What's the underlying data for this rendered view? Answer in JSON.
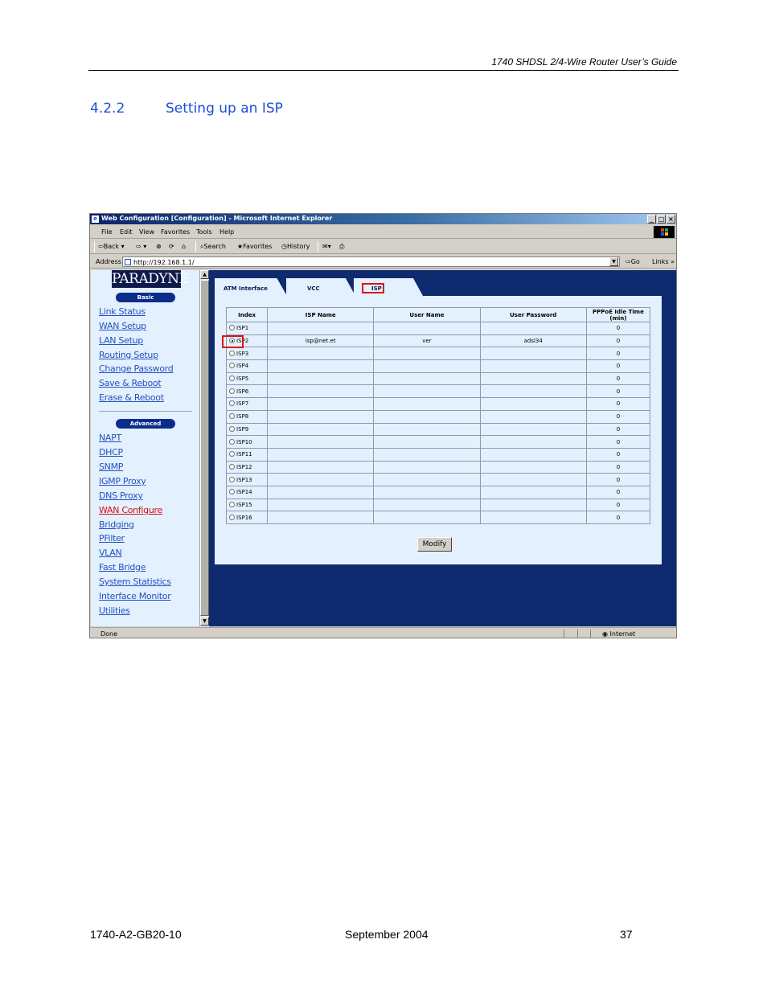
{
  "doc": {
    "header": "1740 SHDSL 2/4-Wire Router User’s Guide",
    "section_number": "4.2.2",
    "section_title": "Setting up an ISP",
    "footer_left": "1740-A2-GB20-10",
    "footer_center": "September 2004",
    "footer_right": "37"
  },
  "browser": {
    "title": "Web Configuration [Configuration] - Microsoft Internet Explorer",
    "menu": [
      "File",
      "Edit",
      "View",
      "Favorites",
      "Tools",
      "Help"
    ],
    "toolbar": {
      "back": "Back",
      "search": "Search",
      "favorites": "Favorites",
      "history": "History"
    },
    "address_label": "Address",
    "url": "http://192.168.1.1/",
    "go": "Go",
    "links": "Links",
    "status_done": "Done",
    "status_zone": "Internet"
  },
  "sidebar": {
    "logo": "PARADYNE",
    "basic_label": "Basic",
    "basic_items": [
      "Link Status",
      "WAN Setup",
      "LAN Setup",
      "Routing Setup",
      "Change Password",
      "Save & Reboot",
      "Erase & Reboot"
    ],
    "advanced_label": "Advanced",
    "advanced_items": [
      "NAPT",
      "DHCP",
      "SNMP",
      "IGMP Proxy",
      "DNS Proxy",
      "WAN Configure",
      "Bridging",
      "PFilter",
      "VLAN",
      "Fast Bridge",
      "System Statistics",
      "Interface Monitor",
      "Utilities"
    ],
    "active_item": "WAN Configure"
  },
  "tabs": [
    "ATM Interface",
    "VCC",
    "ISP"
  ],
  "active_tab": "ISP",
  "table": {
    "headers": [
      "Index",
      "ISP Name",
      "User Name",
      "User Password",
      "PPPoE Idle Time",
      "(min)"
    ],
    "rows": [
      {
        "index": "ISP1",
        "isp": "",
        "user": "",
        "password": "",
        "idle": "0"
      },
      {
        "index": "ISP2",
        "isp": "isp@net.et",
        "user": "ver",
        "password": "adsl34",
        "idle": "0"
      },
      {
        "index": "ISP3",
        "isp": "",
        "user": "",
        "password": "",
        "idle": "0"
      },
      {
        "index": "ISP4",
        "isp": "",
        "user": "",
        "password": "",
        "idle": "0"
      },
      {
        "index": "ISP5",
        "isp": "",
        "user": "",
        "password": "",
        "idle": "0"
      },
      {
        "index": "ISP6",
        "isp": "",
        "user": "",
        "password": "",
        "idle": "0"
      },
      {
        "index": "ISP7",
        "isp": "",
        "user": "",
        "password": "",
        "idle": "0"
      },
      {
        "index": "ISP8",
        "isp": "",
        "user": "",
        "password": "",
        "idle": "0"
      },
      {
        "index": "ISP9",
        "isp": "",
        "user": "",
        "password": "",
        "idle": "0"
      },
      {
        "index": "ISP10",
        "isp": "",
        "user": "",
        "password": "",
        "idle": "0"
      },
      {
        "index": "ISP11",
        "isp": "",
        "user": "",
        "password": "",
        "idle": "0"
      },
      {
        "index": "ISP12",
        "isp": "",
        "user": "",
        "password": "",
        "idle": "0"
      },
      {
        "index": "ISP13",
        "isp": "",
        "user": "",
        "password": "",
        "idle": "0"
      },
      {
        "index": "ISP14",
        "isp": "",
        "user": "",
        "password": "",
        "idle": "0"
      },
      {
        "index": "ISP15",
        "isp": "",
        "user": "",
        "password": "",
        "idle": "0"
      },
      {
        "index": "ISP16",
        "isp": "",
        "user": "",
        "password": "",
        "idle": "0"
      }
    ],
    "selected_row": 1
  },
  "modify_label": "Modify",
  "colors": {
    "nav_link": "#2451c2",
    "active_link": "#d01010",
    "highlight": "#e0101a",
    "panel": "#e3f0fd",
    "background": "#0d2b6e"
  }
}
